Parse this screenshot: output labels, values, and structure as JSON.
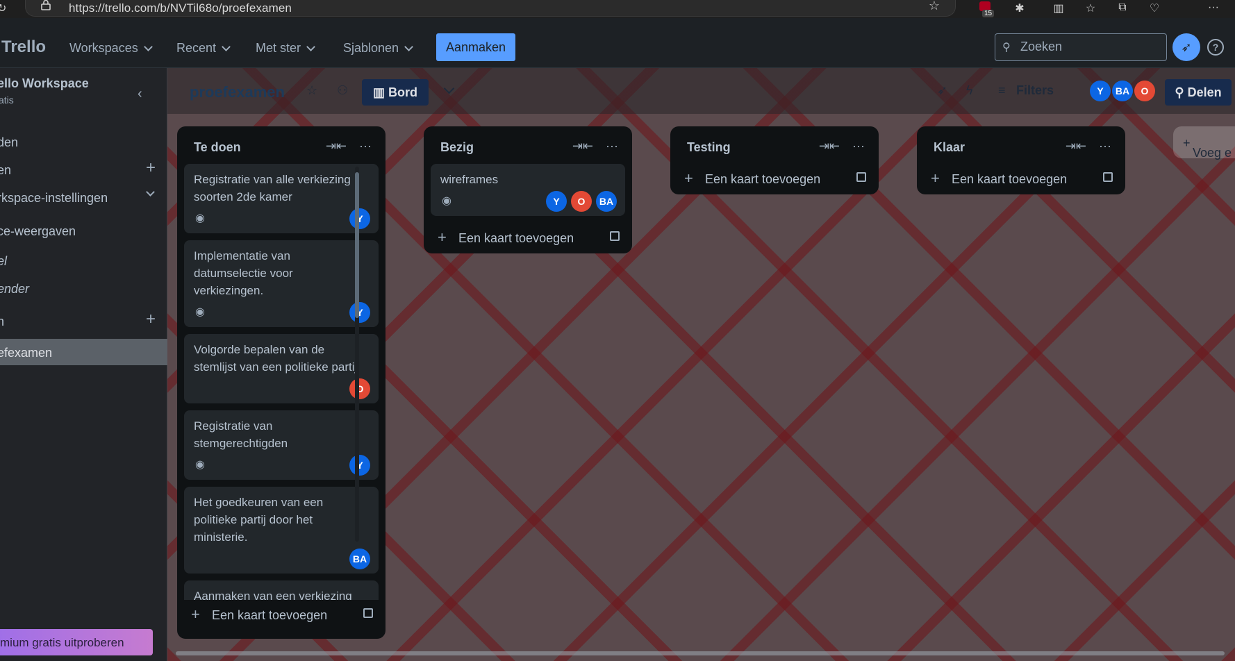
{
  "browser": {
    "url": "https://trello.com/b/NVTil68o/proefexamen",
    "extension_count": "15"
  },
  "header": {
    "logo": "Trello",
    "nav": [
      "Workspaces",
      "Recent",
      "Met ster",
      "Sjablonen"
    ],
    "create_label": "Aanmaken",
    "search_placeholder": "Zoeken"
  },
  "sidebar": {
    "workspace_name": "ello Workspace",
    "workspace_plan": "atis",
    "items": [
      {
        "label": "den"
      },
      {
        "label": "en"
      },
      {
        "label": "rkspace-instellingen"
      },
      {
        "label": "ce-weergaven"
      },
      {
        "label": "el"
      },
      {
        "label": "ender"
      },
      {
        "label": "n"
      }
    ],
    "active_board": "efexamen",
    "premium_label": "mium gratis uitproberen"
  },
  "board": {
    "title": "proefexamen",
    "view_label": "Bord",
    "filters_label": "Filters",
    "share_label": "Delen",
    "members": [
      "Y",
      "BA",
      "O"
    ],
    "add_list_label": "Voeg e",
    "add_card_label": "Een kaart toevoegen",
    "lists": [
      {
        "title": "Te doen",
        "cards": [
          {
            "title": "Registratie van alle verkiezing soorten 2de kamer",
            "watch": true,
            "members": [
              "Y"
            ]
          },
          {
            "title": "Implementatie van datumselectie voor verkiezingen.",
            "watch": true,
            "members": [
              "Y"
            ]
          },
          {
            "title": "Volgorde bepalen van de stemlijst van een politieke partij",
            "watch": false,
            "members": [
              "O"
            ]
          },
          {
            "title": "Registratie van stemgerechtigden",
            "watch": true,
            "members": [
              "Y"
            ]
          },
          {
            "title": "Het goedkeuren van een politieke partij door het ministerie.",
            "watch": false,
            "members": [
              "BA"
            ]
          },
          {
            "title": "Aanmaken van een verkiezing van een bepaalde verkiezingssoort, met",
            "watch": false,
            "members": []
          }
        ]
      },
      {
        "title": "Bezig",
        "cards": [
          {
            "title": "wireframes",
            "watch": true,
            "members": [
              "Y",
              "O",
              "BA"
            ]
          }
        ]
      },
      {
        "title": "Testing",
        "cards": []
      },
      {
        "title": "Klaar",
        "cards": []
      }
    ]
  },
  "colors": {
    "accent": "#579dff",
    "avatar_blue": "#0c66e4",
    "avatar_orange": "#e34935",
    "list_bg": "#0f1214",
    "card_bg": "#22272b"
  }
}
